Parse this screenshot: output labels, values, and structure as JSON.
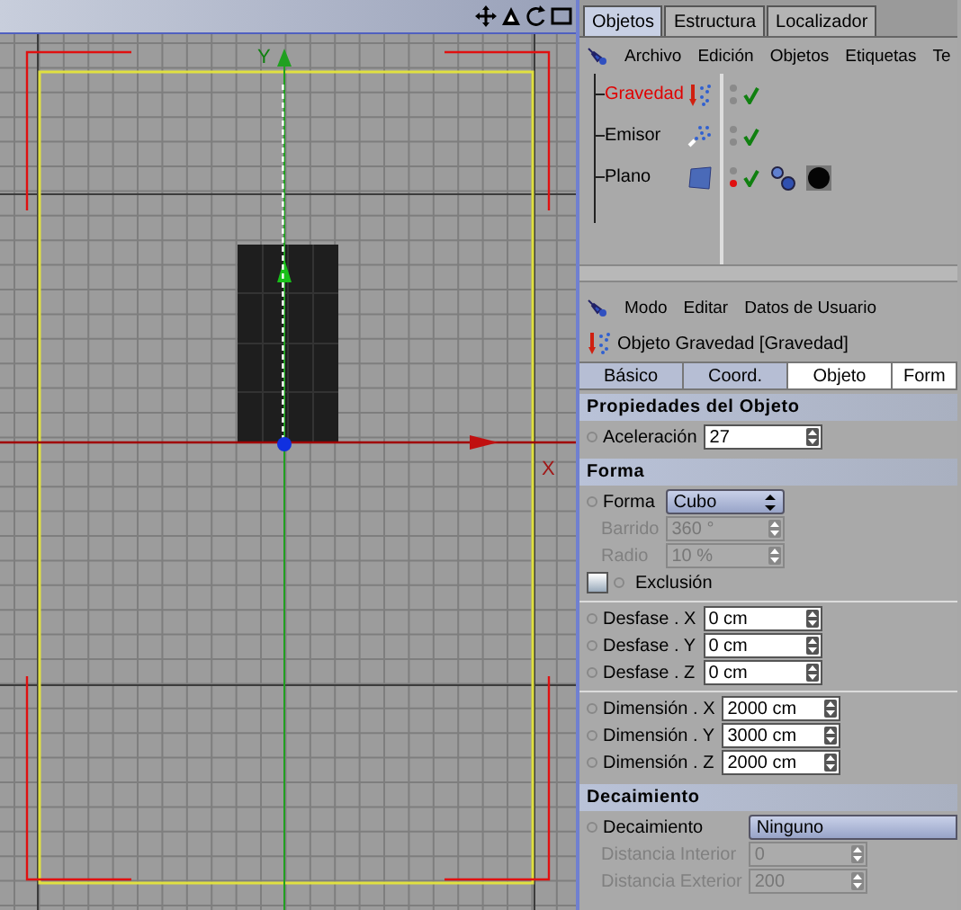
{
  "viewport": {
    "axis_y_label": "Y",
    "axis_x_label": "X"
  },
  "object_manager": {
    "tabs": [
      {
        "label": "Objetos",
        "selected": true
      },
      {
        "label": "Estructura",
        "selected": false
      },
      {
        "label": "Localizador",
        "selected": false
      }
    ],
    "menu": [
      "Archivo",
      "Edición",
      "Objetos",
      "Etiquetas",
      "Te"
    ],
    "objects": [
      {
        "name": "Gravedad",
        "kind": "gravity",
        "selected": true,
        "render_visible": true
      },
      {
        "name": "Emisor",
        "kind": "emitter",
        "selected": false,
        "render_visible": true
      },
      {
        "name": "Plano",
        "kind": "plane",
        "selected": false,
        "render_visible": false,
        "tags": [
          {
            "kind": "phong"
          },
          {
            "kind": "material"
          }
        ]
      }
    ]
  },
  "attribute_manager": {
    "menu": [
      "Modo",
      "Editar",
      "Datos de Usuario"
    ],
    "title": "Objeto Gravedad  [Gravedad]",
    "tabs": [
      {
        "label": "Básico",
        "selected": false
      },
      {
        "label": "Coord.",
        "selected": false
      },
      {
        "label": "Objeto",
        "selected": true
      },
      {
        "label": "Form",
        "selected": true
      }
    ],
    "sections": [
      {
        "title": "Propiedades del Objeto",
        "groups": [
          [
            {
              "kind": "number",
              "label": "Aceleración",
              "value": "27",
              "disabled": false
            }
          ]
        ]
      },
      {
        "title": "Forma",
        "groups": [
          [
            {
              "kind": "dropdown",
              "label": "Forma",
              "value": "Cubo",
              "disabled": false
            },
            {
              "kind": "number",
              "label": "Barrido",
              "value": "360 °",
              "disabled": true
            },
            {
              "kind": "number",
              "label": "Radio",
              "value": "10 %",
              "disabled": true
            },
            {
              "kind": "checkbox",
              "label": "Exclusión",
              "checked": false
            }
          ],
          [
            {
              "kind": "number",
              "label": "Desfase . X",
              "value": "0 cm",
              "disabled": false
            },
            {
              "kind": "number",
              "label": "Desfase . Y",
              "value": "0 cm",
              "disabled": false
            },
            {
              "kind": "number",
              "label": "Desfase . Z",
              "value": "0 cm",
              "disabled": false
            }
          ],
          [
            {
              "kind": "number",
              "label": "Dimensión . X",
              "value": "2000 cm",
              "disabled": false
            },
            {
              "kind": "number",
              "label": "Dimensión . Y",
              "value": "3000 cm",
              "disabled": false
            },
            {
              "kind": "number",
              "label": "Dimensión . Z",
              "value": "2000 cm",
              "disabled": false
            }
          ]
        ]
      },
      {
        "title": "Decaimiento",
        "groups": [
          [
            {
              "kind": "dropdown",
              "label": "Decaimiento",
              "value": "Ninguno",
              "disabled": false,
              "wide": true
            },
            {
              "kind": "number",
              "label": "Distancia Interior",
              "value": "0",
              "disabled": true
            },
            {
              "kind": "number",
              "label": "Distancia Exterior",
              "value": "200",
              "disabled": true
            }
          ]
        ]
      }
    ]
  }
}
